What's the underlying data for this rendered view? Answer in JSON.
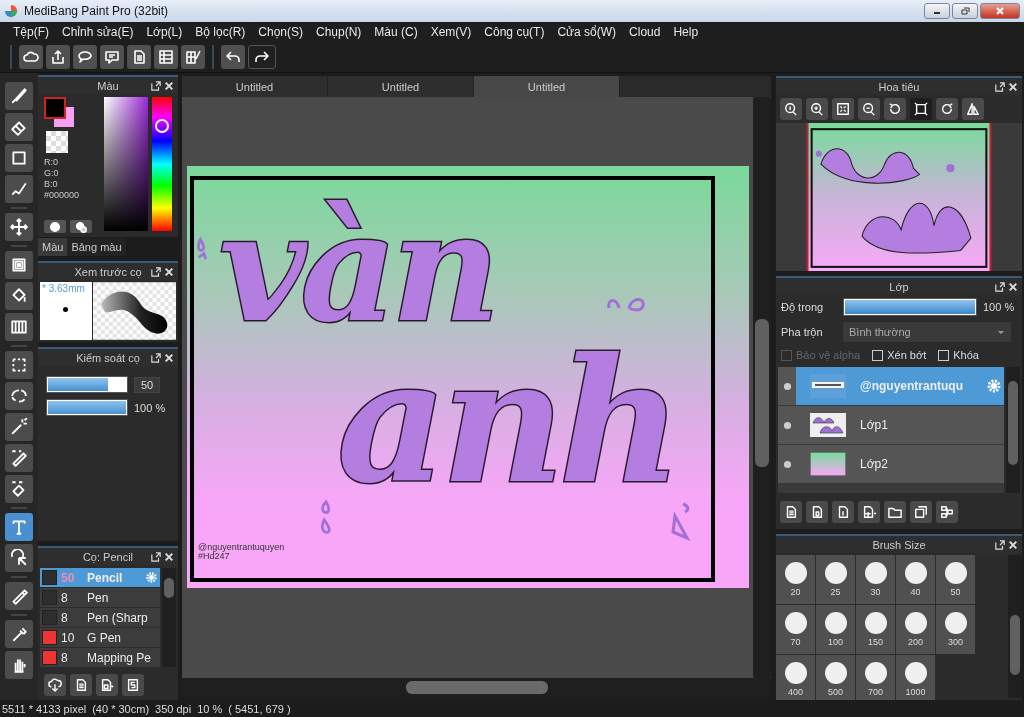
{
  "window": {
    "title": "MediBang Paint Pro (32bit)"
  },
  "menu": [
    "Tệp(F)",
    "Chỉnh sửa(E)",
    "Lớp(L)",
    "Bộ lọc(R)",
    "Chọn(S)",
    "Chụp(N)",
    "Màu (C)",
    "Xem(V)",
    "Công cụ(T)",
    "Cửa sổ(W)",
    "Cloud",
    "Help"
  ],
  "tools": [
    {
      "selected": false
    },
    {
      "selected": false
    },
    {
      "selected": false
    },
    {
      "selected": false
    },
    {
      "selected": false
    },
    {
      "selected": false
    },
    {
      "selected": false
    },
    {
      "selected": false
    },
    {
      "selected": false
    },
    {
      "selected": false
    },
    {
      "selected": false
    },
    {
      "selected": false
    },
    {
      "selected": false
    },
    {
      "selected": true
    },
    {
      "selected": false
    },
    {
      "selected": false
    },
    {
      "selected": false
    },
    {
      "selected": false
    }
  ],
  "color_panel": {
    "title": "Màu",
    "rgb": [
      "R:0",
      "G:0",
      "B:0"
    ],
    "hex": "#000000",
    "tabs": [
      {
        "label": "Màu",
        "selected": true
      },
      {
        "label": "Bảng màu",
        "selected": false
      }
    ]
  },
  "brush_preview": {
    "title": "Xem trước cọ",
    "size": "* 3.63mm"
  },
  "brush_control": {
    "title": "Kiểm soát cọ",
    "sliders": [
      {
        "level": 0.77,
        "value": "50"
      },
      {
        "level": 1,
        "value": "100 %"
      }
    ]
  },
  "brushes": {
    "title": "Cọ: Pencil",
    "items": [
      {
        "size": "50",
        "name": "Pencil",
        "color": "#2e2e2e",
        "selected": true
      },
      {
        "size": "8",
        "name": "Pen",
        "color": "#2e2e2e",
        "selected": false
      },
      {
        "size": "8",
        "name": "Pen (Sharp",
        "color": "#2e2e2e",
        "selected": false
      },
      {
        "size": "10",
        "name": "G Pen",
        "color": "#ee3535",
        "selected": false
      },
      {
        "size": "8",
        "name": "Mapping Pe",
        "color": "#ee3535",
        "selected": false
      }
    ]
  },
  "document_tabs": [
    {
      "label": "Untitled",
      "selected": false
    },
    {
      "label": "Untitled",
      "selected": false
    },
    {
      "label": "Untitled",
      "selected": true
    }
  ],
  "canvas": {
    "lettering": [
      "vàn",
      "anh"
    ],
    "signature": [
      "@nguyentrantuquyen",
      "#Hd247"
    ]
  },
  "navigator": {
    "title": "Hoa tiêu"
  },
  "layers": {
    "title": "Lớp",
    "opacity_label": "Độ trong",
    "opacity": {
      "level": 1,
      "value": "100 %"
    },
    "blend_label": "Pha trộn",
    "blend": "Bình thường",
    "options": [
      {
        "label": "Bảo vệ alpha",
        "checked": false,
        "disabled": true
      },
      {
        "label": "Xén bớt",
        "checked": false,
        "disabled": false
      },
      {
        "label": "Khóa",
        "checked": false,
        "disabled": false
      }
    ],
    "items": [
      {
        "name": "@nguyentrantuqu",
        "selected": true
      },
      {
        "name": "Lớp1",
        "selected": false
      },
      {
        "name": "Lớp2",
        "selected": false
      }
    ]
  },
  "brush_size": {
    "title": "Brush Size",
    "sizes": [
      "20",
      "25",
      "30",
      "40",
      "50",
      "70",
      "100",
      "150",
      "200",
      "300",
      "400",
      "500",
      "700",
      "1000"
    ]
  },
  "status": [
    "5511 * 4133 pixel",
    "(40 * 30cm)",
    "350 dpi",
    "10 %",
    "( 5451, 679 )"
  ]
}
